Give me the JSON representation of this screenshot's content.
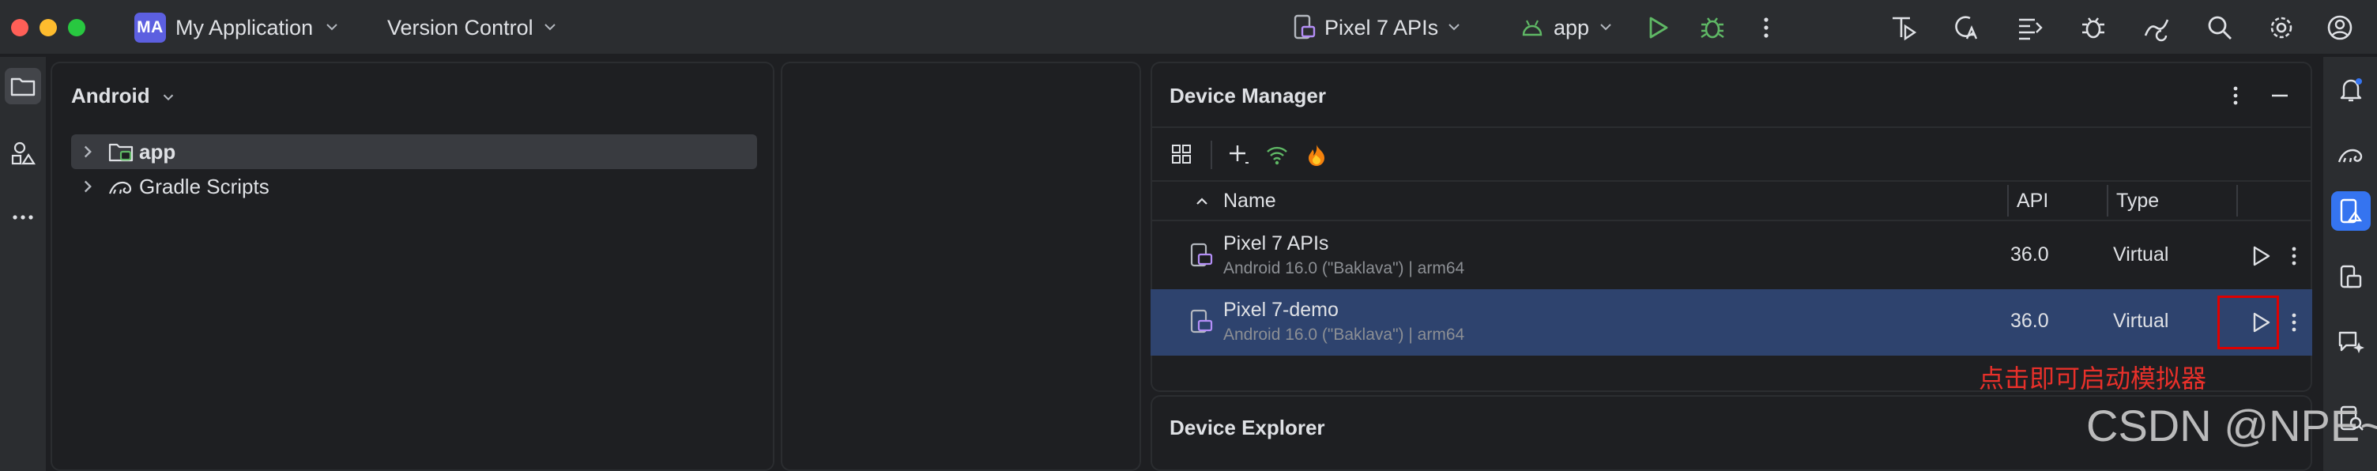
{
  "titlebar": {
    "project_badge": "MA",
    "project_name": "My Application",
    "vcs": "Version Control",
    "device": "Pixel 7 APIs",
    "run_config": "app",
    "icons": [
      "run-icon",
      "debug-icon",
      "more-icon",
      "profiler-icon",
      "translate-icon",
      "logcat-icon",
      "bug-icon",
      "sync-icon",
      "search-icon",
      "settings-icon",
      "account-icon"
    ]
  },
  "project_panel": {
    "view": "Android",
    "tree": [
      {
        "label": "app",
        "bold": true,
        "selected": true
      },
      {
        "label": "Gradle Scripts",
        "bold": false,
        "selected": false
      }
    ]
  },
  "device_manager": {
    "title": "Device Manager",
    "columns": {
      "name": "Name",
      "api": "API",
      "type": "Type"
    },
    "devices": [
      {
        "name": "Pixel 7 APIs",
        "detail": "Android 16.0 (\"Baklava\") | arm64",
        "api": "36.0",
        "type": "Virtual",
        "selected": false
      },
      {
        "name": "Pixel 7-demo",
        "detail": "Android 16.0 (\"Baklava\") | arm64",
        "api": "36.0",
        "type": "Virtual",
        "selected": true
      }
    ]
  },
  "device_explorer": {
    "title": "Device Explorer"
  },
  "annotation": "点击即可启动模拟器",
  "watermark": "CSDN @NPE~",
  "colors": {
    "accent": "#3574f0",
    "run": "#5fb865",
    "annotation": "#e8302a",
    "selected_row": "#2e436e"
  }
}
